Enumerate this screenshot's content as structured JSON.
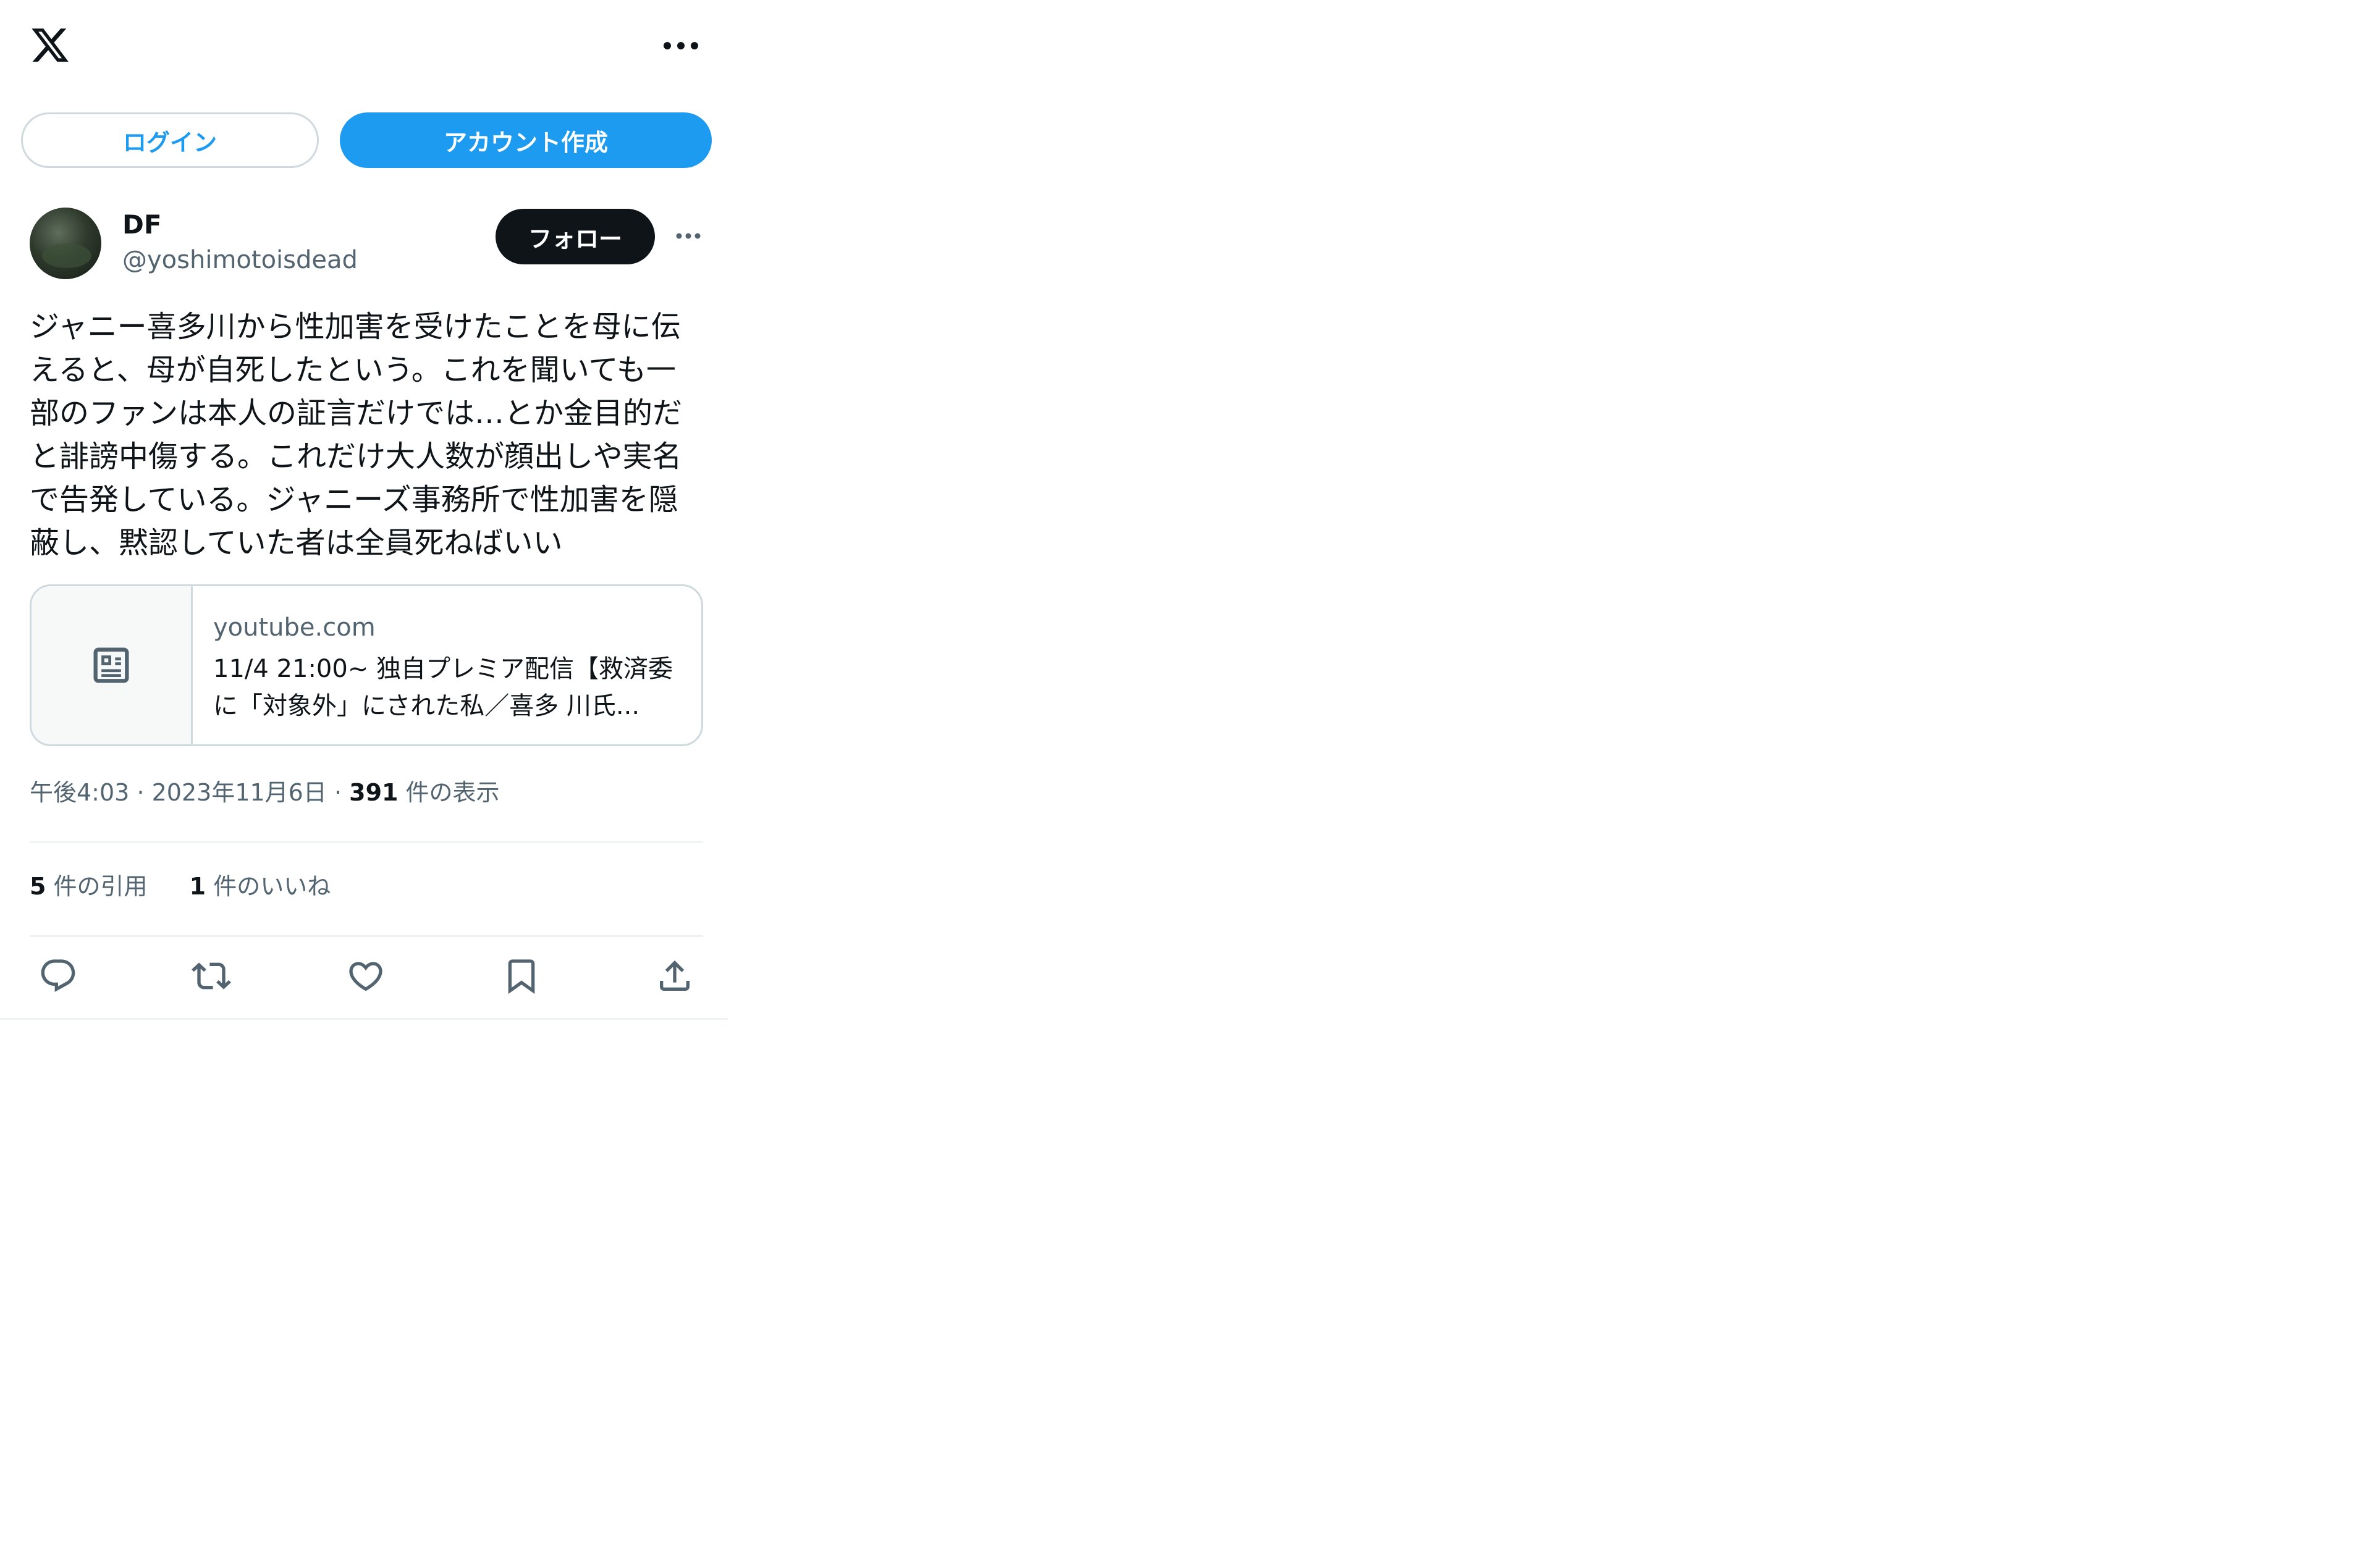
{
  "header": {
    "logo_icon": "x-logo-icon",
    "more_icon": "more-horizontal-icon"
  },
  "auth": {
    "login_label": "ログイン",
    "signup_label": "アカウント作成"
  },
  "tweet": {
    "author": {
      "display_name": "DF",
      "handle": "@yoshimotoisdead"
    },
    "follow_label": "フォロー",
    "text": "ジャニー喜多川から性加害を受けたことを母に伝えると、母が自死したという。これを聞いても一部のファンは本人の証言だけでは…とか金目的だと誹謗中傷する。これだけ大人数が顔出しや実名で告発している。ジャニーズ事務所で性加害を隠蔽し、黙認していた者は全員死ねばいい",
    "card": {
      "domain": "youtube.com",
      "title": "11/4 21:00~ 独自プレミア配信【救済委に「対象外」にされた私／喜多 川氏..."
    },
    "time": "午後4:03",
    "date": "2023年11月6日",
    "views_count": "391",
    "views_label": "件の表示",
    "quotes_count": "5",
    "quotes_label": "件の引用",
    "likes_count": "1",
    "likes_label": "件のいいね"
  },
  "colors": {
    "accent": "#1d9bf0",
    "text": "#0f1419",
    "secondary": "#536471",
    "border": "#cfd9de",
    "divider": "#eff3f4"
  }
}
